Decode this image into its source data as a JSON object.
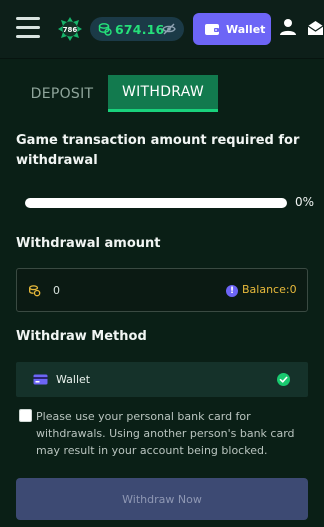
{
  "header": {
    "logo_text": "786",
    "balance": "674.16",
    "wallet_label": "Wallet"
  },
  "tabs": [
    {
      "label": "DEPOSIT",
      "active": false
    },
    {
      "label": "WITHDRAW",
      "active": true
    }
  ],
  "requirement": {
    "label": "Game transaction amount required for withdrawal",
    "progress_percent": 0,
    "progress_text": "0%"
  },
  "amount": {
    "label": "Withdrawal amount",
    "value": "0",
    "balance_text": "Balance:0"
  },
  "method": {
    "label": "Withdraw Method",
    "selected": "Wallet"
  },
  "consent": {
    "checked": false,
    "text": "Please use your personal bank card for withdrawals. Using another person's bank card may result in your account being blocked."
  },
  "submit_label": "Withdraw Now",
  "colors": {
    "background": "#0a1f16",
    "accent_green": "#19d27c",
    "wallet_purple": "#6d65f6",
    "balance_yellow": "#e7b93b"
  }
}
